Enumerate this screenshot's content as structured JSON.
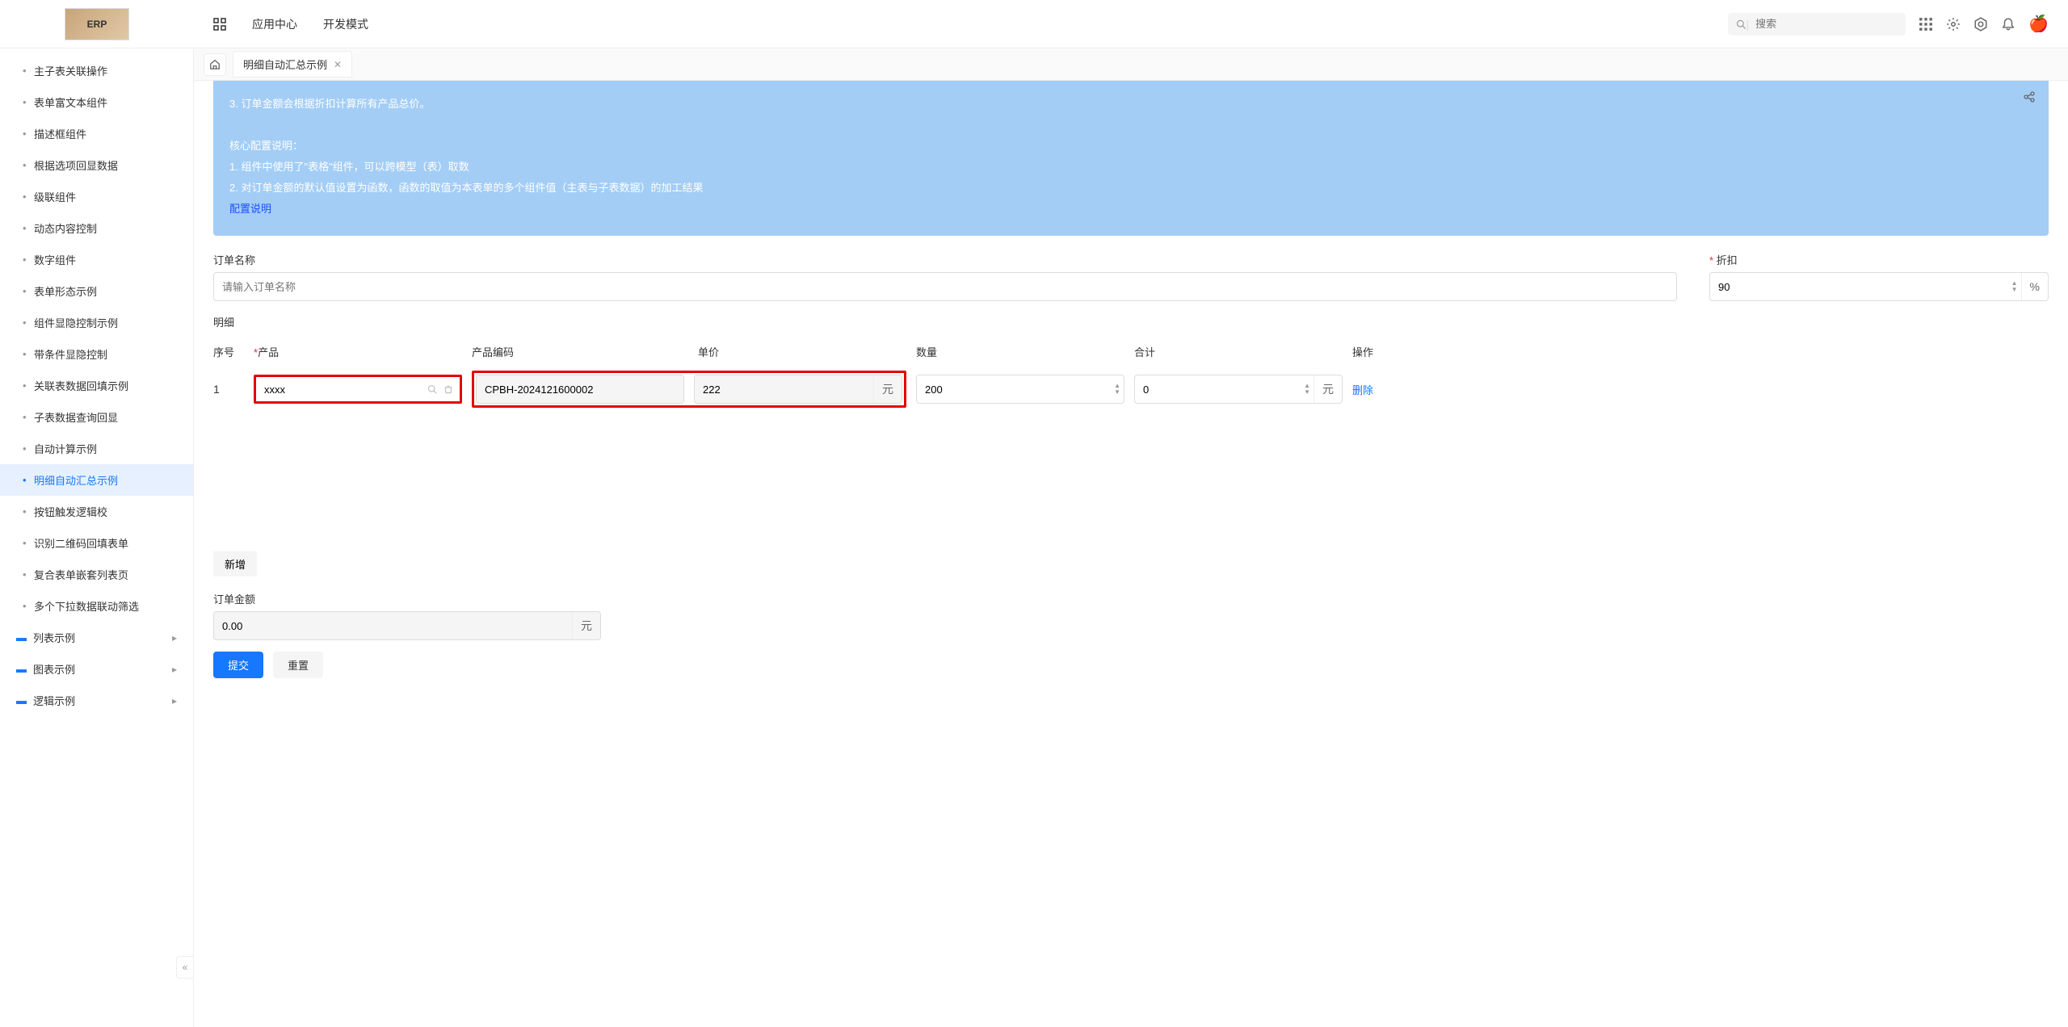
{
  "header": {
    "logo_text": "ERP",
    "nav": {
      "app_center": "应用中心",
      "dev_mode": "开发模式"
    },
    "search_placeholder": "搜索"
  },
  "sidebar": {
    "items": [
      "主子表关联操作",
      "表单富文本组件",
      "描述框组件",
      "根据选项回显数据",
      "级联组件",
      "动态内容控制",
      "数字组件",
      "表单形态示例",
      "组件显隐控制示例",
      "带条件显隐控制",
      "关联表数据回填示例",
      "子表数据查询回显",
      "自动计算示例",
      "明细自动汇总示例",
      "按钮触发逻辑校",
      "识别二维码回填表单",
      "复合表单嵌套列表页",
      "多个下拉数据联动筛选"
    ],
    "folders": [
      "列表示例",
      "图表示例",
      "逻辑示例"
    ]
  },
  "tab": {
    "title": "明细自动汇总示例"
  },
  "banner": {
    "line1": "3. 订单金额会根据折扣计算所有产品总价。",
    "core_title": "核心配置说明：",
    "core1": "1. 组件中使用了\"表格\"组件，可以跨模型（表）取数",
    "core2": "2. 对订单金额的默认值设置为函数，函数的取值为本表单的多个组件值（主表与子表数据）的加工结果",
    "config_link": "配置说明"
  },
  "form": {
    "order_name_label": "订单名称",
    "order_name_placeholder": "请输入订单名称",
    "discount_label": "折扣",
    "discount_value": "90",
    "discount_unit": "%",
    "detail_label": "明细",
    "columns": {
      "seq": "序号",
      "product": "产品",
      "code": "产品编码",
      "price": "单价",
      "qty": "数量",
      "total": "合计",
      "action": "操作"
    },
    "row": {
      "seq": "1",
      "product": "xxxx",
      "code": "CPBH-2024121600002",
      "price": "222",
      "price_unit": "元",
      "qty": "200",
      "total": "0",
      "total_unit": "元",
      "delete": "删除"
    },
    "add_label": "新增",
    "order_amount_label": "订单金额",
    "order_amount_value": "0.00",
    "order_amount_unit": "元",
    "submit": "提交",
    "reset": "重置"
  }
}
